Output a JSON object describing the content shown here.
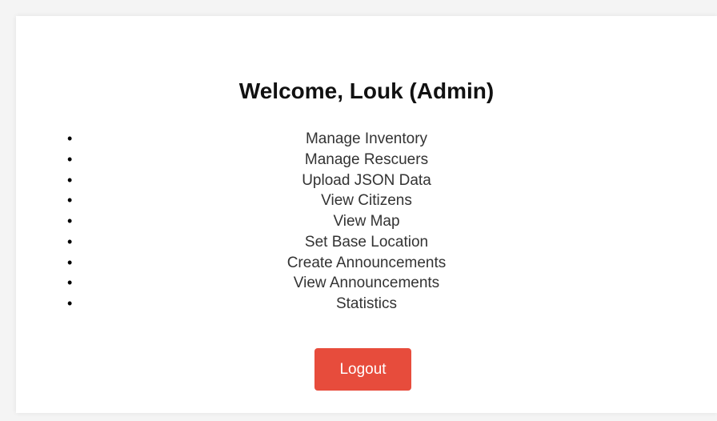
{
  "page": {
    "title": "Welcome, Louk (Admin)"
  },
  "menu": {
    "items": [
      {
        "label": "Manage Inventory"
      },
      {
        "label": "Manage Rescuers"
      },
      {
        "label": "Upload JSON Data"
      },
      {
        "label": "View Citizens"
      },
      {
        "label": "View Map"
      },
      {
        "label": "Set Base Location"
      },
      {
        "label": "Create Announcements"
      },
      {
        "label": "View Announcements"
      },
      {
        "label": "Statistics"
      }
    ]
  },
  "actions": {
    "logout_label": "Logout"
  },
  "colors": {
    "logout_button": "#e74c3c",
    "page_background": "#f4f4f4",
    "card_background": "#ffffff",
    "link_text": "#333333"
  }
}
